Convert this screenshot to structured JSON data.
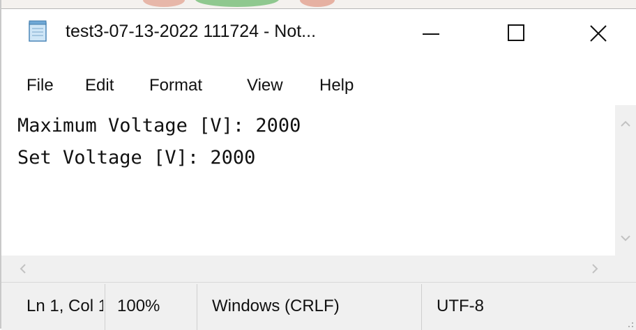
{
  "window": {
    "title": "test3-07-13-2022 111724 - Not...",
    "icon": "notepad-icon",
    "controls": [
      "minimize-icon",
      "maximize-icon",
      "close-icon"
    ]
  },
  "menu": {
    "items": [
      "File",
      "Edit",
      "Format",
      "View",
      "Help"
    ]
  },
  "editor": {
    "lines": [
      "Maximum Voltage [V]: 2000",
      "Set Voltage [V]: 2000"
    ]
  },
  "statusbar": {
    "position": "Ln 1, Col 1",
    "zoom": "100%",
    "line_ending": "Windows (CRLF)",
    "encoding": "UTF-8"
  }
}
